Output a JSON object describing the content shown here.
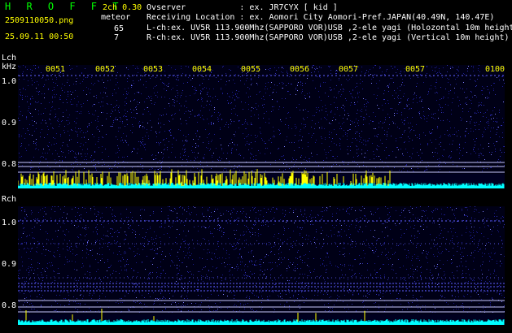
{
  "header": {
    "title": "H R O F F T",
    "version": "2ch 0.30",
    "filename": "2509110050.png",
    "datetime": "25.09.11 00:50",
    "meteor_label": "meteor",
    "meteor_lch": "65",
    "meteor_rch": "7",
    "observer": "Ovserver           : ex. JR7CYX [ kid ]",
    "location": "Receiving Location : ex. Aomori City Aomori-Pref.JAPAN(40.49N, 140.47E)",
    "lch_info": "L-ch:ex. UV5R 113.900Mhz(SAPPORO VOR)USB ,2-ele yagi (Holozontal 10m height)",
    "rch_info": "R-ch:ex. UV5R 113.900Mhz(SAPPORO VOR)USB ,2-ele yagi (Vertical 10m height)"
  },
  "lch": {
    "label": "Lch",
    "unit": "kHz",
    "yticks": [
      "1.0",
      "0.9",
      "0.8"
    ]
  },
  "rch": {
    "label": "Rch",
    "yticks": [
      "1.0",
      "0.9",
      "0.8"
    ]
  },
  "time_ticks": [
    "0051",
    "0052",
    "0053",
    "0054",
    "0055",
    "0056",
    "0057",
    "0057",
    "0100"
  ],
  "colors": {
    "background": "#000000",
    "noise": "#1a1a8c",
    "line": "#c8c8ff",
    "level_cyan": "#00ffff",
    "level_yellow": "#ffff00",
    "title_green": "#00ff00"
  }
}
